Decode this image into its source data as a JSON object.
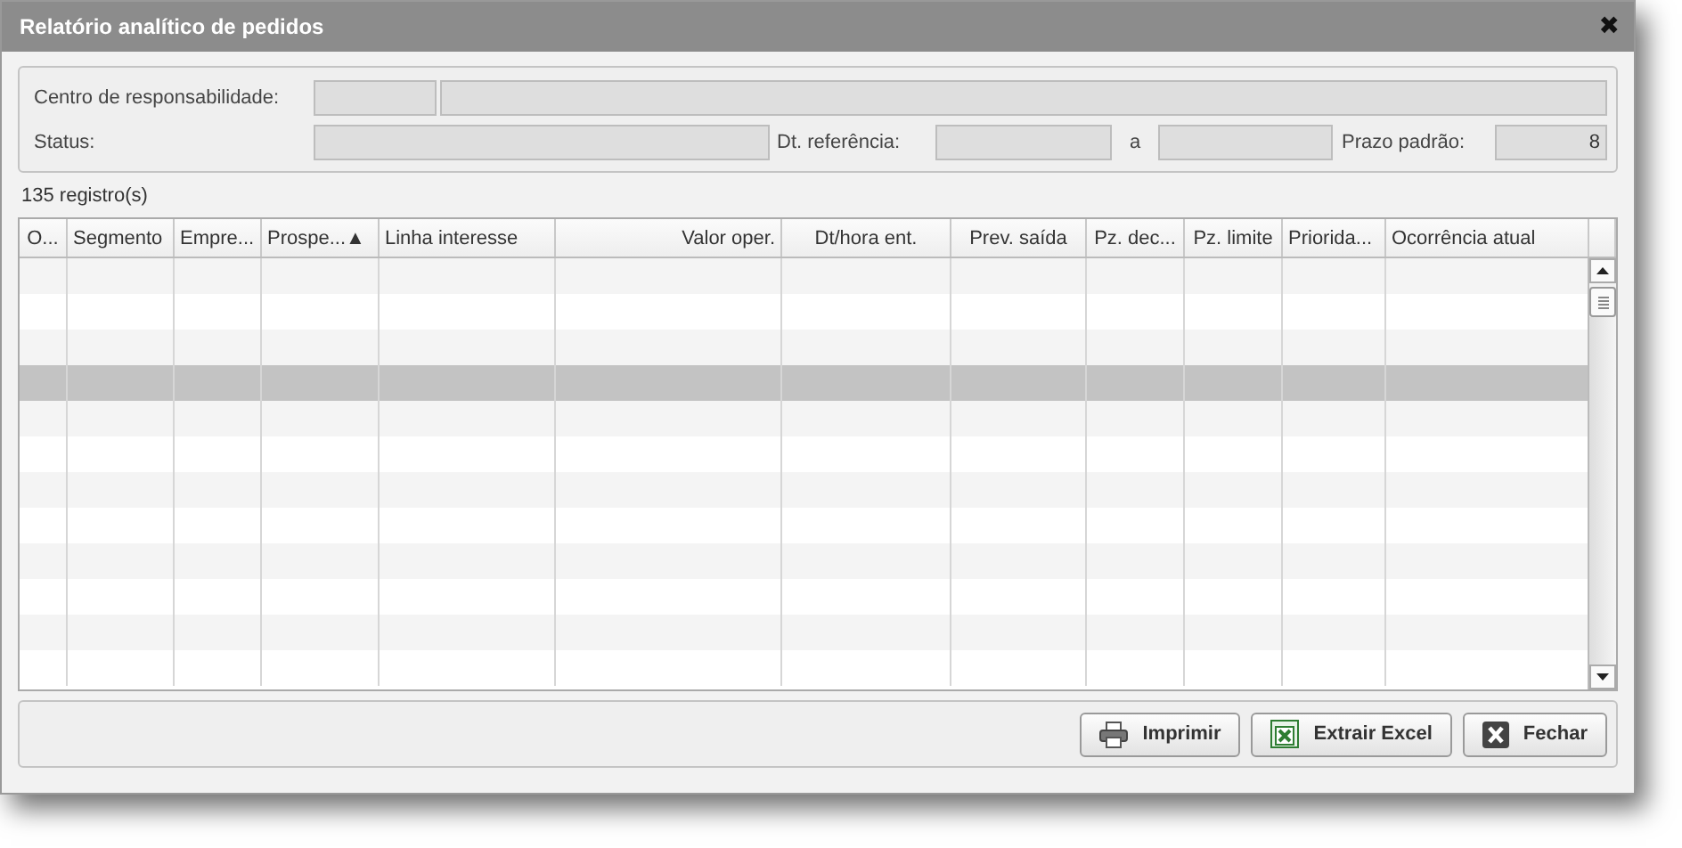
{
  "window": {
    "title": "Relatório analítico de pedidos",
    "close": "✖"
  },
  "filters": {
    "centro_label": "Centro de responsabilidade:",
    "status_label": "Status:",
    "dt_label": "Dt. referência:",
    "range_sep": "a",
    "prazo_label": "Prazo padrão:",
    "prazo_value": "8"
  },
  "record_count": "135 registro(s)",
  "table": {
    "columns": [
      {
        "label": "O..."
      },
      {
        "label": "Segmento"
      },
      {
        "label": "Empre..."
      },
      {
        "label": "Prospe...▲"
      },
      {
        "label": "Linha interesse"
      },
      {
        "label": "Valor oper."
      },
      {
        "label": "Dt/hora ent."
      },
      {
        "label": "Prev. saída"
      },
      {
        "label": "Pz. dec..."
      },
      {
        "label": "Pz. limite"
      },
      {
        "label": "Priorida..."
      },
      {
        "label": "Ocorrência atual"
      }
    ],
    "rows": [
      {
        "selected": false
      },
      {
        "selected": false
      },
      {
        "selected": false
      },
      {
        "selected": true
      },
      {
        "selected": false
      },
      {
        "selected": false
      },
      {
        "selected": false
      },
      {
        "selected": false
      },
      {
        "selected": false
      },
      {
        "selected": false
      },
      {
        "selected": false
      },
      {
        "selected": false
      }
    ]
  },
  "buttons": [
    {
      "label": "Imprimir",
      "kind": "print"
    },
    {
      "label": "Extrair Excel",
      "kind": "excel"
    },
    {
      "label": "Fechar",
      "kind": "close"
    }
  ]
}
